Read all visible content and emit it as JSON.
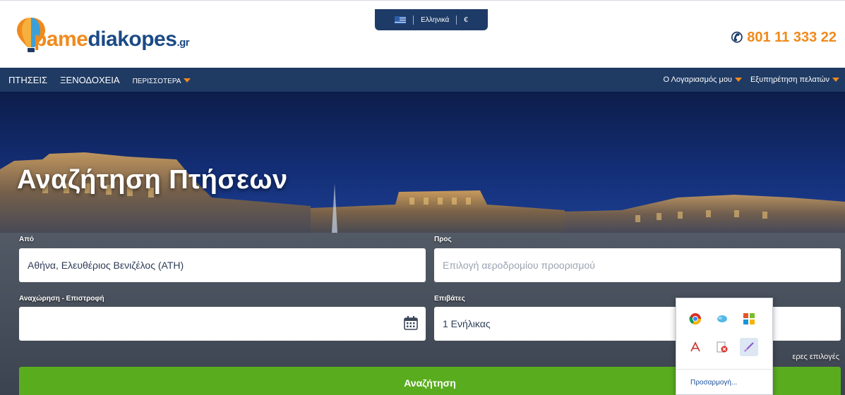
{
  "header": {
    "logo": {
      "part1": "pame",
      "part2": "diakopes",
      "suffix": ".gr"
    },
    "language_switch": {
      "language": "Ελληνικά",
      "currency": "€"
    },
    "phone": "801 11 333 22"
  },
  "nav": {
    "items": [
      {
        "label": "ΠΤΗΣΕΙΣ"
      },
      {
        "label": "ΞΕΝΟΔΟΧΕΙΑ"
      },
      {
        "label": "ΠΕΡΙΣΣΟΤΕΡΑ"
      }
    ],
    "account": "Ο Λογαριασμός μου",
    "support": "Εξυπηρέτηση πελατών"
  },
  "search": {
    "title": "Αναζήτηση Πτήσεων",
    "from_label": "Από",
    "from_value": "Αθήνα, Ελευθέριος Βενιζέλος (ATH)",
    "to_label": "Προς",
    "to_placeholder": "Επιλογή αεροδρομίου προορισμού",
    "dates_label": "Αναχώρηση - Επιστροφή",
    "dates_value": "",
    "passengers_label": "Επιβάτες",
    "passengers_value": "1 Ενήλικας",
    "more_options": "ερες επιλογές",
    "button": "Αναζήτηση"
  },
  "popup": {
    "icons": [
      "chrome-icon",
      "skype-icon",
      "office-icon",
      "acrobat-icon",
      "pdf-icon",
      "pen-tool-icon"
    ],
    "customize": "Προσαρμογή..."
  },
  "colors": {
    "brand_orange": "#f08a1c",
    "brand_navy": "#1f3a63",
    "search_green": "#5aac1f"
  }
}
